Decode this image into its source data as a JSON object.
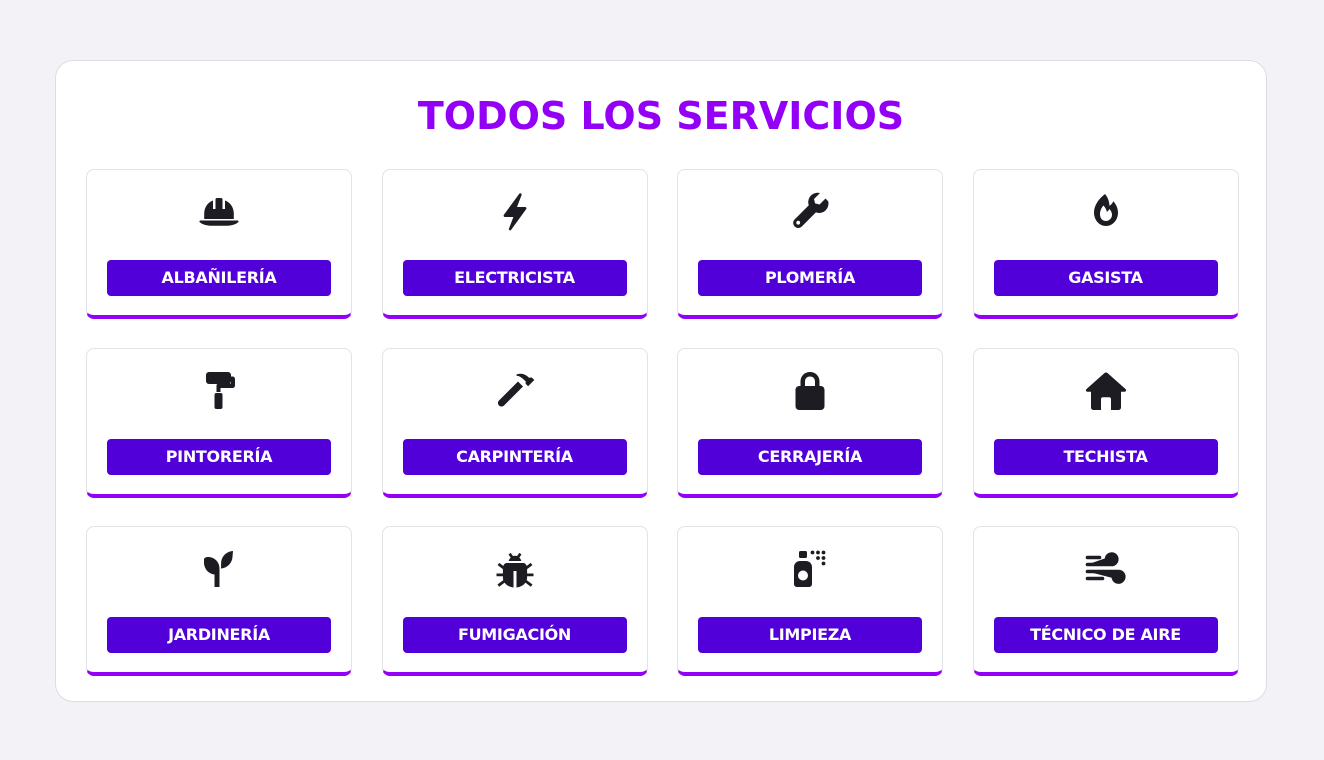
{
  "page": {
    "title": "TODOS LOS SERVICIOS"
  },
  "colors": {
    "accent": "#9400f5",
    "button": "#5200d9",
    "icon": "#1c1c22",
    "background": "#f3f3f7"
  },
  "services": [
    {
      "label": "ALBAÑILERÍA",
      "icon": "hard-hat-icon"
    },
    {
      "label": "ELECTRICISTA",
      "icon": "bolt-icon"
    },
    {
      "label": "PLOMERÍA",
      "icon": "wrench-icon"
    },
    {
      "label": "GASISTA",
      "icon": "fire-icon"
    },
    {
      "label": "PINTORERÍA",
      "icon": "paint-roller-icon"
    },
    {
      "label": "CARPINTERÍA",
      "icon": "hammer-icon"
    },
    {
      "label": "CERRAJERÍA",
      "icon": "lock-icon"
    },
    {
      "label": "TECHISTA",
      "icon": "house-icon"
    },
    {
      "label": "JARDINERÍA",
      "icon": "seedling-icon"
    },
    {
      "label": "FUMIGACIÓN",
      "icon": "bug-icon"
    },
    {
      "label": "LIMPIEZA",
      "icon": "spray-can-icon"
    },
    {
      "label": "TÉCNICO DE AIRE",
      "icon": "wind-icon"
    }
  ]
}
